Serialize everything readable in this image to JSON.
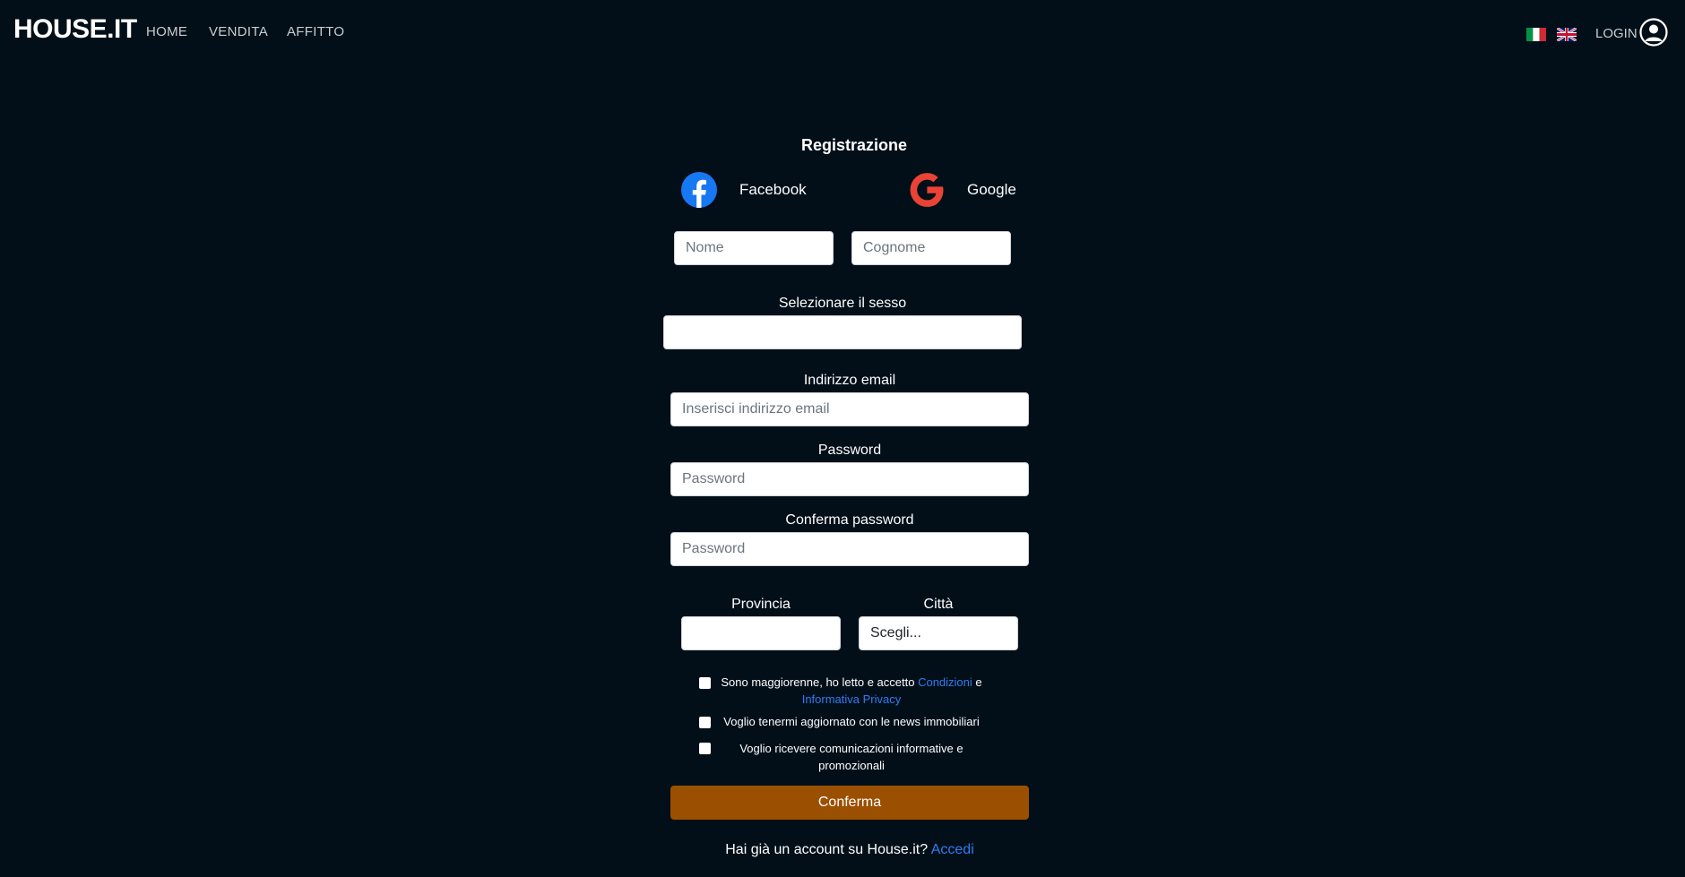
{
  "nav": {
    "brand": "HOUSE.IT",
    "links": [
      "HOME",
      "VENDITA",
      "AFFITTO"
    ],
    "login": "LOGIN"
  },
  "form": {
    "title": "Registrazione",
    "social": {
      "facebook": "Facebook",
      "google": "Google"
    },
    "nome_placeholder": "Nome",
    "cognome_placeholder": "Cognome",
    "sesso_label": "Selezionare il sesso",
    "sesso_value": "",
    "email_label": "Indirizzo email",
    "email_placeholder": "Inserisci indirizzo email",
    "password_label": "Password",
    "password_placeholder": "Password",
    "confirm_password_label": "Conferma password",
    "confirm_password_placeholder": "Password",
    "provincia_label": "Provincia",
    "provincia_value": "",
    "citta_label": "Città",
    "citta_value": "Scegli...",
    "checks": {
      "terms_text": "Sono maggiorenne, ho letto e accetto",
      "terms_link1": "Condizioni",
      "terms_and": "e",
      "terms_link2": "Informativa Privacy",
      "news": "Voglio tenermi aggiornato con le news immobiliari",
      "promo": "Voglio ricevere comunicazioni informative e promozionali"
    },
    "confirm_button": "Conferma",
    "footer_text": "Hai già un account su House.it?",
    "footer_link": "Accedi"
  },
  "colors": {
    "background": "#020f18",
    "accent_button": "#9b4f00",
    "link": "#2f7cf6",
    "facebook": "#1877f2",
    "google": "#ea4335"
  },
  "icons": {
    "facebook": "facebook-icon",
    "google": "google-icon",
    "user": "user-circle-icon",
    "flag_it": "italy-flag-icon",
    "flag_uk": "uk-flag-icon"
  }
}
